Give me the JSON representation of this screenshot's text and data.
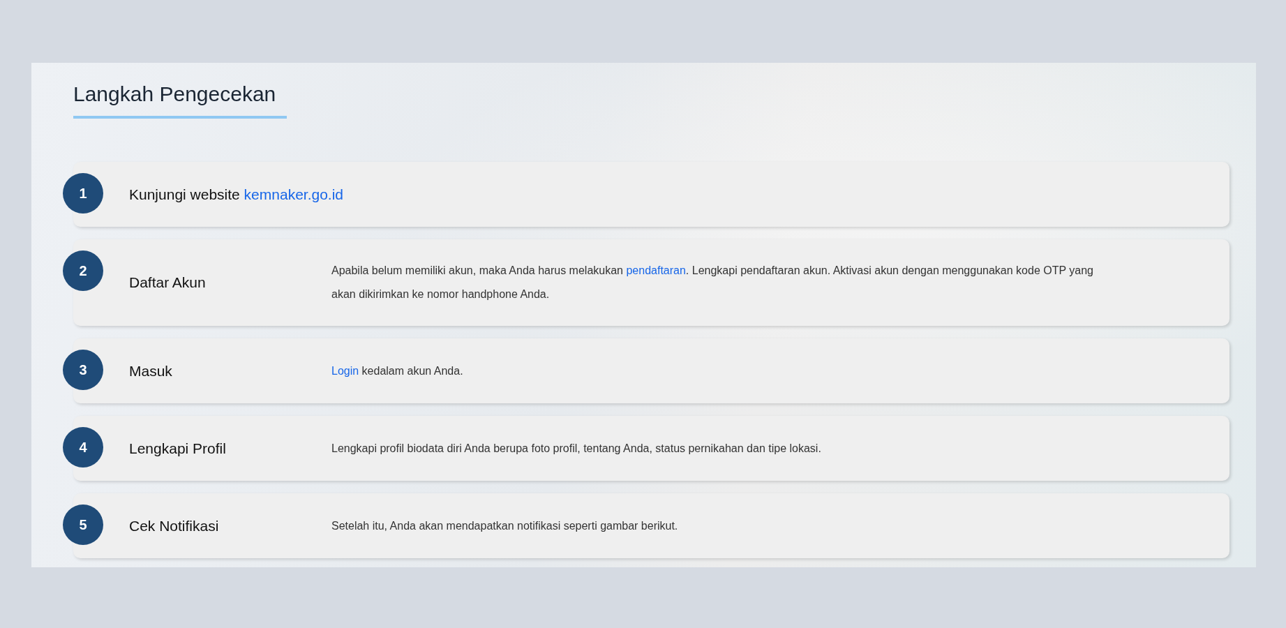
{
  "heading": "Langkah Pengecekan",
  "steps": [
    {
      "number": "1",
      "title": "Kunjungi website",
      "title_link": "kemnaker.go.id"
    },
    {
      "number": "2",
      "title": "Daftar Akun",
      "description": [
        {
          "kind": "text",
          "text": "Apabila belum memiliki akun, maka Anda harus melakukan "
        },
        {
          "kind": "link",
          "text": "pendaftaran"
        },
        {
          "kind": "text",
          "text": ". Lengkapi pendaftaran akun. Aktivasi akun dengan menggunakan kode OTP yang akan dikirimkan ke nomor handphone Anda."
        }
      ]
    },
    {
      "number": "3",
      "title": "Masuk",
      "description": [
        {
          "kind": "link",
          "text": "Login"
        },
        {
          "kind": "text",
          "text": " kedalam akun Anda."
        }
      ]
    },
    {
      "number": "4",
      "title": "Lengkapi Profil",
      "description": [
        {
          "kind": "text",
          "text": "Lengkapi profil biodata diri Anda berupa foto profil, tentang Anda, status pernikahan dan tipe lokasi."
        }
      ]
    },
    {
      "number": "5",
      "title": "Cek Notifikasi",
      "description": [
        {
          "kind": "text",
          "text": "Setelah itu, Anda akan mendapatkan notifikasi seperti gambar berikut."
        }
      ]
    }
  ]
}
